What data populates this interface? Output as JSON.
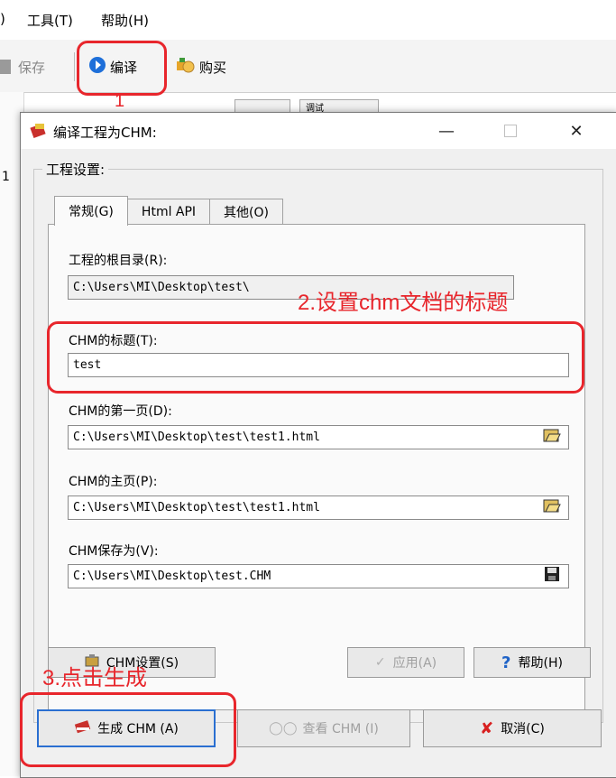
{
  "menu": {
    "first_partial": ")",
    "tools": "工具(T)",
    "help": "帮助(H)"
  },
  "toolbar": {
    "save": "保存",
    "compile": "编译",
    "buy": "购买"
  },
  "background": {
    "tab_text": "调试",
    "left_fragment": "1"
  },
  "dialog": {
    "title": "编译工程为CHM:",
    "group_label": "工程设置:",
    "tabs": [
      "常规(G)",
      "Html API",
      "其他(O)"
    ],
    "fields": {
      "root_label": "工程的根目录(R):",
      "root_value": "C:\\Users\\MI\\Desktop\\test\\",
      "title_label": "CHM的标题(T):",
      "title_value": "test",
      "first_page_label": "CHM的第一页(D):",
      "first_page_value": "C:\\Users\\MI\\Desktop\\test\\test1.html",
      "home_label": "CHM的主页(P):",
      "home_value": "C:\\Users\\MI\\Desktop\\test\\test1.html",
      "save_label": "CHM保存为(V):",
      "save_value": "C:\\Users\\MI\\Desktop\\test.CHM"
    },
    "buttons": {
      "chm_settings": "CHM设置(S)",
      "apply": "应用(A)",
      "help": "帮助(H)",
      "generate": "生成 CHM (A)",
      "view": "查看 CHM (I)",
      "cancel": "取消(C)"
    }
  },
  "annotations": {
    "step1": "1",
    "step2": "2.设置chm文档的标题",
    "step3": "3.点击生成"
  },
  "colors": {
    "annotation_red": "#e8262c",
    "dialog_bg": "#f0f0f0",
    "focus_blue": "#2a6fd1"
  },
  "icons": [
    "save-icon",
    "compile-icon",
    "buy-icon",
    "app-icon",
    "minimize-icon",
    "maximize-icon",
    "close-icon",
    "folder-open-icon",
    "floppy-icon",
    "settings-icon",
    "check-icon",
    "help-icon",
    "book-icon",
    "view-icon",
    "cancel-x-icon"
  ]
}
